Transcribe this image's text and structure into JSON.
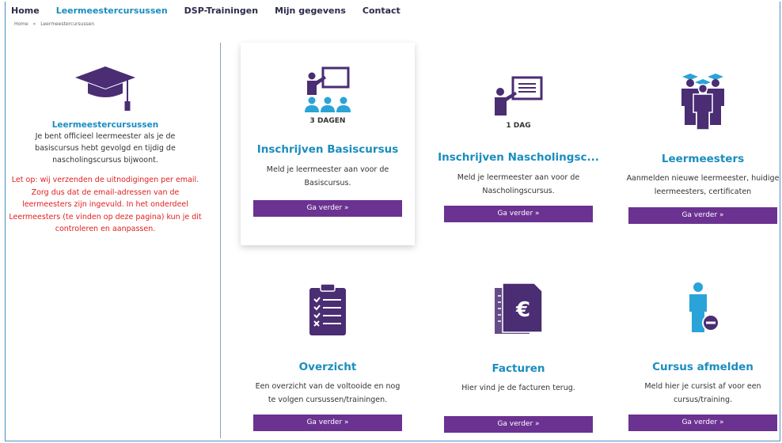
{
  "nav": {
    "items": [
      "Home",
      "Leermeestercursussen",
      "DSP-Trainingen",
      "Mijn gegevens",
      "Contact"
    ],
    "active_index": 1
  },
  "breadcrumb": {
    "home": "Home",
    "separator": "»",
    "current": "Leermeestercursussen"
  },
  "sidebar": {
    "icon": "graduation-cap-icon",
    "title": "Leermeestercursussen",
    "description": "Je bent officieel leermeester als je de basiscursus hebt gevolgd en tijdig de nascholingscursus bijwoont.",
    "warning": "Let op: wij verzenden de uitnodigingen per email. Zorg dus dat de email-adressen van de leermeesters zijn ingevuld. In het onderdeel Leermeesters (te vinden op deze pagina) kun je dit controleren en aanpassen."
  },
  "cards": [
    {
      "icon": "classroom-teacher-icon",
      "days": "3 DAGEN",
      "title": "Inschrijven Basiscursus",
      "text": "Meld je leermeester aan voor de Basiscursus.",
      "button": "Ga verder »"
    },
    {
      "icon": "presentation-icon",
      "days": "1 DAG",
      "title": "Inschrijven Nascholingsc...",
      "text": "Meld je leermeester aan voor de Nascholingscursus.",
      "button": "Ga verder »"
    },
    {
      "icon": "graduates-group-icon",
      "days": "",
      "title": "Leermeesters",
      "text": "Aanmelden nieuwe leermeester, huidige leermeesters, certificaten",
      "button": "Ga verder »"
    },
    {
      "icon": "checklist-clipboard-icon",
      "days": "",
      "title": "Overzicht",
      "text": "Een overzicht van de voltooide en nog te volgen cursussen/trainingen.",
      "button": "Ga verder »"
    },
    {
      "icon": "euro-invoice-icon",
      "days": "",
      "title": "Facturen",
      "text": "Hier vind je de facturen terug.",
      "button": "Ga verder »"
    },
    {
      "icon": "person-remove-icon",
      "days": "",
      "title": "Cursus afmelden",
      "text": "Meld hier je cursist af voor een cursus/training.",
      "button": "Ga verder »"
    }
  ],
  "colors": {
    "accent_blue": "#1a8dbf",
    "button_purple": "#6b3291",
    "icon_purple": "#4a2d73",
    "icon_blue": "#2aa3d8",
    "warning_red": "#e02020"
  }
}
